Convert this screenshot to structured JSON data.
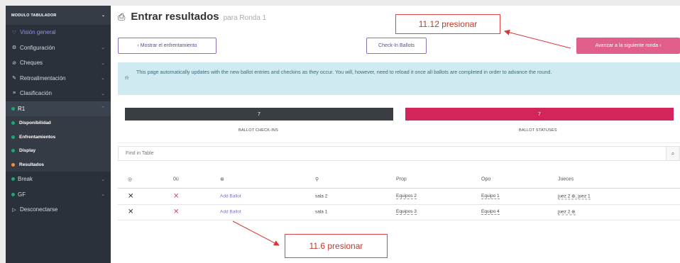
{
  "sidebar": {
    "module_title": "MODULO TABULADOR",
    "items": [
      {
        "label": "Visión general",
        "icon": "heart-icon",
        "glyph": "♡"
      },
      {
        "label": "Configuración",
        "icon": "gear-icon",
        "glyph": "⚙"
      },
      {
        "label": "Cheques",
        "icon": "check-icon",
        "glyph": "⊘"
      },
      {
        "label": "Retroalimentación",
        "icon": "comment-icon",
        "glyph": "✎"
      },
      {
        "label": "Clasificación",
        "icon": "ranking-icon",
        "glyph": "≡"
      }
    ],
    "round": {
      "label": "R1"
    },
    "sub_items": [
      "Disponibilidad",
      "Enfrentamientos",
      "Display",
      "Resultados"
    ],
    "after": [
      {
        "label": "Break"
      },
      {
        "label": "GF"
      },
      {
        "label": "Desconectarse"
      }
    ]
  },
  "header": {
    "title": "Entrar resultados",
    "subtitle": "para Ronda 1"
  },
  "buttons": {
    "show_pairing": "‹ Mostrar el enfrentamiento",
    "check_in": "Check-In Ballots",
    "advance": "Avanzar a la siguiente ronda ›"
  },
  "info": {
    "text": "This page automatically updates with the new ballot entries and checkins as they occur. You will, however, need to reload it once all ballots are completed in order to advance the round."
  },
  "stats": {
    "checkins_value": "7",
    "checkins_label": "BALLOT CHECK-INS",
    "statuses_value": "7",
    "statuses_label": "BALLOT STATUSES",
    "colors": {
      "checkins": "#3a3d42",
      "statuses": "#d3245c"
    }
  },
  "search": {
    "placeholder": "Find in Table"
  },
  "table": {
    "headers": {
      "col1_icon": "target-icon",
      "col2": "0ü",
      "col3_icon": "plus-circle-icon",
      "col4_icon": "location-icon",
      "prop": "Prop",
      "opp": "Opo",
      "judges": "Jueces"
    },
    "rows": [
      {
        "add": "Add Ballot",
        "room": "sala 2",
        "prop": "Equipos 2",
        "opp": "Equipo 1",
        "judges": "juez 2 ⊕, juez 1"
      },
      {
        "add": "Add Ballot",
        "room": "sala 1",
        "prop": "Equipos 3",
        "opp": "Equipo 4",
        "judges": "juez 2 ⊕"
      }
    ]
  },
  "annotations": {
    "top": "11.12 presionar",
    "bottom": "11.6 presionar"
  }
}
